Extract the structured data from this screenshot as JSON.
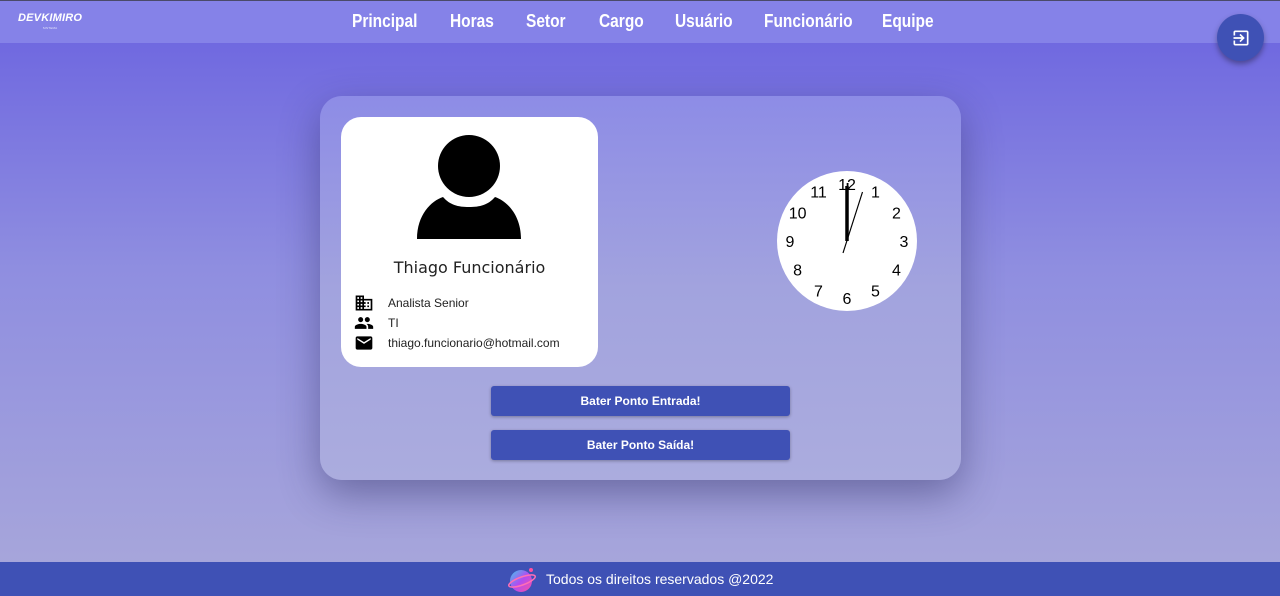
{
  "header": {
    "logo": "DEVKIMIRO",
    "logo_sub": "SISTEMA",
    "nav": [
      {
        "label": "Principal"
      },
      {
        "label": "Horas"
      },
      {
        "label": "Setor"
      },
      {
        "label": "Cargo"
      },
      {
        "label": "Usuário"
      },
      {
        "label": "Funcionário"
      },
      {
        "label": "Equipe"
      }
    ],
    "logout_icon": "logout-icon"
  },
  "profile": {
    "name": "Thiago Funcionário",
    "role": "Analista Senior",
    "team": "TI",
    "email": "thiago.funcionario@hotmail.com",
    "icons": [
      "building-icon",
      "people-icon",
      "mail-icon"
    ]
  },
  "clock": {
    "numbers": [
      "12",
      "1",
      "2",
      "3",
      "4",
      "5",
      "6",
      "7",
      "8",
      "9",
      "10",
      "11"
    ],
    "time": "12:04"
  },
  "actions": {
    "clock_in": "Bater Ponto Entrada!",
    "clock_out": "Bater Ponto Saída!"
  },
  "footer": {
    "text": "Todos os direitos reservados @2022"
  },
  "colors": {
    "primary": "#3f51b5",
    "header": "#8582e8",
    "background_top": "#6a62e0",
    "background_bottom": "#a9a8da"
  }
}
